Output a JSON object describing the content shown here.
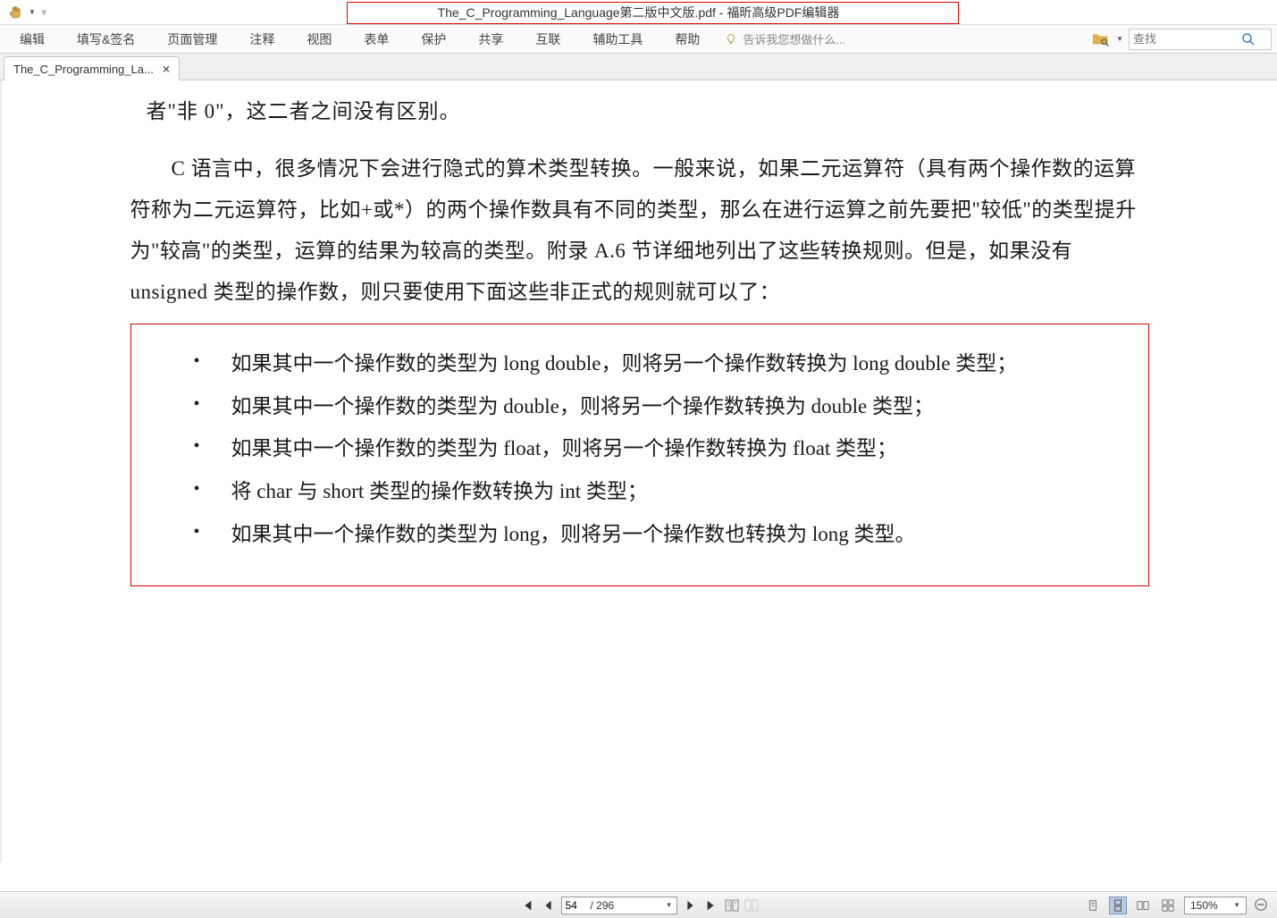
{
  "title": "The_C_Programming_Language第二版中文版.pdf - 福昕高级PDF编辑器",
  "menu": {
    "items": [
      "编辑",
      "填写&签名",
      "页面管理",
      "注释",
      "视图",
      "表单",
      "保护",
      "共享",
      "互联",
      "辅助工具",
      "帮助"
    ],
    "tell_me": "告诉我您想做什么..."
  },
  "search": {
    "placeholder": "查找"
  },
  "tab": {
    "label": "The_C_Programming_La..."
  },
  "document": {
    "truncated_line": "者\"非 0\"，这二者之间没有区别。",
    "paragraph": "C 语言中，很多情况下会进行隐式的算术类型转换。一般来说，如果二元运算符（具有两个操作数的运算符称为二元运算符，比如+或*）的两个操作数具有不同的类型，那么在进行运算之前先要把\"较低\"的类型提升为\"较高\"的类型，运算的结果为较高的类型。附录 A.6 节详细地列出了这些转换规则。但是，如果没有 unsigned 类型的操作数，则只要使用下面这些非正式的规则就可以了：",
    "rules": [
      "如果其中一个操作数的类型为 long double，则将另一个操作数转换为 long double 类型；",
      "如果其中一个操作数的类型为 double，则将另一个操作数转换为 double 类型；",
      "如果其中一个操作数的类型为 float，则将另一个操作数转换为 float 类型；",
      "将 char 与 short 类型的操作数转换为 int 类型；",
      "如果其中一个操作数的类型为 long，则将另一个操作数也转换为 long 类型。"
    ]
  },
  "status": {
    "current_page": "54",
    "total_pages": "/ 296",
    "zoom": "150%"
  }
}
